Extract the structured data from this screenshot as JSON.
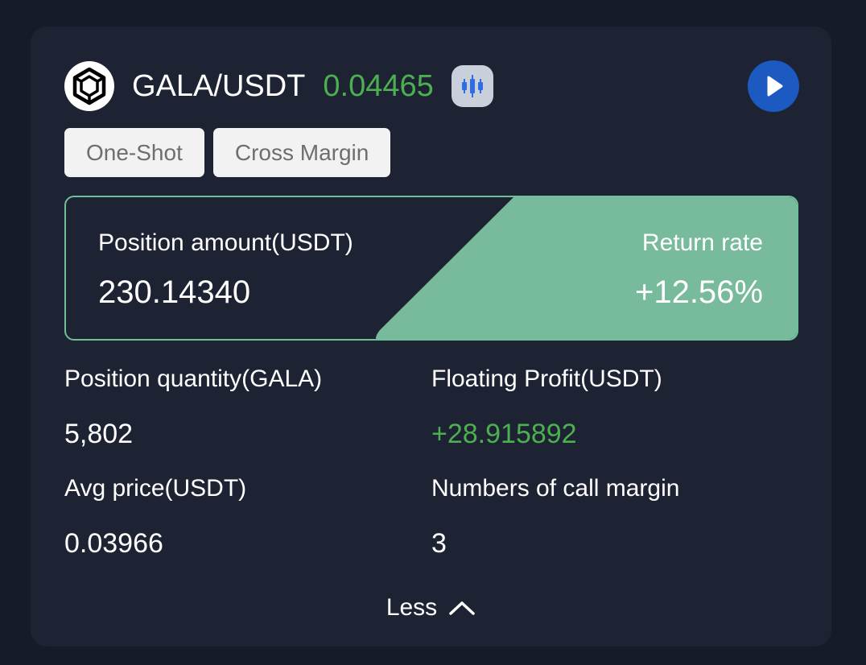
{
  "header": {
    "pair": "GALA/USDT",
    "price": "0.04465",
    "logo_icon": "gala-logo-icon",
    "chart_icon": "candlestick-chart-icon",
    "play_icon": "play-icon"
  },
  "tags": [
    "One-Shot",
    "Cross Margin"
  ],
  "summary": {
    "position_amount_label": "Position amount(USDT)",
    "position_amount_value": "230.14340",
    "return_rate_label": "Return rate",
    "return_rate_value": "+12.56%"
  },
  "stats": {
    "position_quantity_label": "Position quantity(GALA)",
    "position_quantity_value": "5,802",
    "floating_profit_label": "Floating Profit(USDT)",
    "floating_profit_value": "+28.915892",
    "avg_price_label": "Avg price(USDT)",
    "avg_price_value": "0.03966",
    "call_margin_label": "Numbers of call margin",
    "call_margin_value": "3"
  },
  "footer": {
    "less_label": "Less",
    "less_icon": "chevron-up-icon"
  },
  "colors": {
    "background": "#151b29",
    "card": "#1e2334",
    "positive_green": "#4caf50",
    "return_panel": "#78bb9c",
    "play_button": "#1c5ac2"
  }
}
